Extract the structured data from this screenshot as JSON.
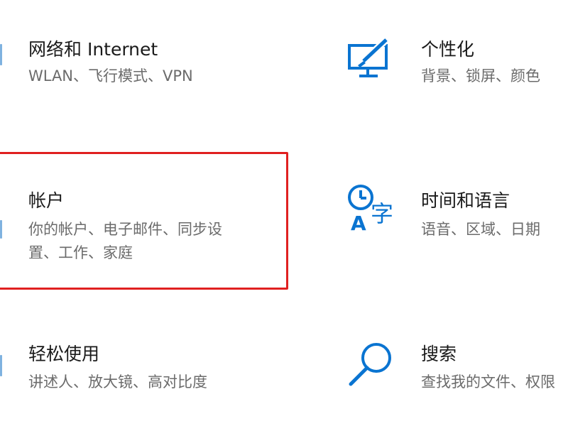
{
  "settings": {
    "tiles": [
      {
        "title": "网络和 Internet",
        "desc_lines": [
          "WLAN、飞行模式、VPN"
        ]
      },
      {
        "title": "个性化",
        "desc_lines": [
          "背景、锁屏、颜色"
        ]
      },
      {
        "title": "帐户",
        "desc_lines": [
          "你的帐户、电子邮件、同步设",
          "置、工作、家庭"
        ]
      },
      {
        "title": "时间和语言",
        "desc_lines": [
          "语音、区域、日期"
        ]
      },
      {
        "title": "轻松使用",
        "desc_lines": [
          "讲述人、放大镜、高对比度"
        ]
      },
      {
        "title": "搜索",
        "desc_lines": [
          "查找我的文件、权限"
        ]
      }
    ]
  },
  "colors": {
    "accent": "#0a74d1",
    "highlight": "#e02020",
    "title_text": "#1a1a1a",
    "desc_text": "#6b6b6b"
  },
  "icons": {
    "network": "network-icon",
    "personalization": "personalization-icon",
    "accounts": "accounts-icon",
    "time_language": "time-language-icon",
    "ease_of_access": "ease-of-access-icon",
    "search": "search-icon"
  }
}
